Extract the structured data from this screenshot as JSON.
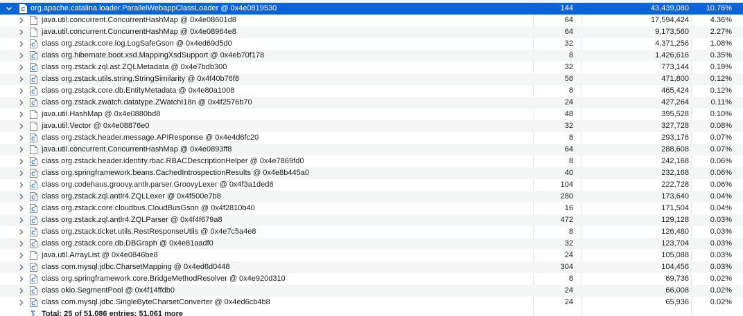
{
  "root": {
    "label": "org.apache.catalina.loader.ParallelWebappClassLoader @ 0x4e0819530",
    "objects": "144",
    "retained": "43,439,080",
    "percent": "10.76%",
    "icon": "class-loader-icon"
  },
  "rows": [
    {
      "type": "object",
      "label": "java.util.concurrent.ConcurrentHashMap @ 0x4e08601d8",
      "objects": "64",
      "retained": "17,594,424",
      "percent": "4.36%"
    },
    {
      "type": "object",
      "label": "java.util.concurrent.ConcurrentHashMap @ 0x4e08964e8",
      "objects": "64",
      "retained": "9,173,560",
      "percent": "2.27%"
    },
    {
      "type": "class",
      "label": "class org.zstack.core.log.LogSafeGson @ 0x4ed69d5d0",
      "objects": "32",
      "retained": "4,371,256",
      "percent": "1.08%"
    },
    {
      "type": "class",
      "label": "class org.hibernate.boot.xsd.MappingXsdSupport @ 0x4eb70f178",
      "objects": "8",
      "retained": "1,426,616",
      "percent": "0.35%"
    },
    {
      "type": "class",
      "label": "class org.zstack.zql.ast.ZQLMetadata @ 0x4e7bdb300",
      "objects": "32",
      "retained": "773,144",
      "percent": "0.19%"
    },
    {
      "type": "class",
      "label": "class org.zstack.utils.string.StringSimilarity @ 0x4f40b76f8",
      "objects": "56",
      "retained": "471,800",
      "percent": "0.12%"
    },
    {
      "type": "class",
      "label": "class org.zstack.core.db.EntityMetadata @ 0x4e80a1008",
      "objects": "8",
      "retained": "465,424",
      "percent": "0.12%"
    },
    {
      "type": "class",
      "label": "class org.zstack.zwatch.datatype.ZWatchI18n @ 0x4f2576b70",
      "objects": "24",
      "retained": "427,264",
      "percent": "0.11%"
    },
    {
      "type": "object",
      "label": "java.util.HashMap @ 0x4e0880bd8",
      "objects": "48",
      "retained": "395,528",
      "percent": "0.10%"
    },
    {
      "type": "object",
      "label": "java.util.Vector @ 0x4e08876e0",
      "objects": "32",
      "retained": "327,728",
      "percent": "0.08%"
    },
    {
      "type": "class",
      "label": "class org.zstack.header.message.APIResponse @ 0x4e4d6fc20",
      "objects": "8",
      "retained": "293,176",
      "percent": "0.07%"
    },
    {
      "type": "object",
      "label": "java.util.concurrent.ConcurrentHashMap @ 0x4e0893ff8",
      "objects": "64",
      "retained": "288,608",
      "percent": "0.07%"
    },
    {
      "type": "class",
      "label": "class org.zstack.header.identity.rbac.RBACDescriptionHelper @ 0x4e7869fd0",
      "objects": "8",
      "retained": "242,168",
      "percent": "0.06%"
    },
    {
      "type": "class",
      "label": "class org.springframework.beans.CachedIntrospectionResults @ 0x4e8b445a0",
      "objects": "40",
      "retained": "232,168",
      "percent": "0.06%"
    },
    {
      "type": "class",
      "label": "class org.codehaus.groovy.antlr.parser.GroovyLexer @ 0x4f3a1ded8",
      "objects": "104",
      "retained": "222,728",
      "percent": "0.06%"
    },
    {
      "type": "class",
      "label": "class org.zstack.zql.antlr4.ZQLLexer @ 0x4f500e7b8",
      "objects": "280",
      "retained": "173,640",
      "percent": "0.04%"
    },
    {
      "type": "class",
      "label": "class org.zstack.core.cloudbus.CloudBusGson @ 0x4f2810b40",
      "objects": "16",
      "retained": "171,504",
      "percent": "0.04%"
    },
    {
      "type": "class",
      "label": "class org.zstack.zql.antlr4.ZQLParser @ 0x4f4f679a8",
      "objects": "472",
      "retained": "129,128",
      "percent": "0.03%"
    },
    {
      "type": "class",
      "label": "class org.zstack.ticket.utils.RestResponseUtils @ 0x4e7c5a4e8",
      "objects": "8",
      "retained": "126,480",
      "percent": "0.03%"
    },
    {
      "type": "class",
      "label": "class org.zstack.core.db.DBGraph @ 0x4e81aadf0",
      "objects": "32",
      "retained": "123,704",
      "percent": "0.03%"
    },
    {
      "type": "object",
      "label": "java.util.ArrayList @ 0x4e0846be8",
      "objects": "24",
      "retained": "105,088",
      "percent": "0.03%"
    },
    {
      "type": "class",
      "label": "class com.mysql.jdbc.CharsetMapping @ 0x4ed6d0448",
      "objects": "304",
      "retained": "104,456",
      "percent": "0.03%"
    },
    {
      "type": "class",
      "label": "class org.springframework.core.BridgeMethodResolver @ 0x4e920d310",
      "objects": "8",
      "retained": "69,736",
      "percent": "0.02%"
    },
    {
      "type": "class",
      "label": "class okio.SegmentPool @ 0x4f14ffdb0",
      "objects": "24",
      "retained": "66,008",
      "percent": "0.02%"
    },
    {
      "type": "class",
      "label": "class com.mysql.jdbc.SingleByteCharsetConverter @ 0x4ed6cb4b8",
      "objects": "24",
      "retained": "65,936",
      "percent": "0.02%"
    }
  ],
  "footer": {
    "sigma": "∑",
    "total": "Total: 25 of 51,086 entries; 51,061 more"
  },
  "colors": {
    "selection": "#0a64d6",
    "alt_row": "#f4f5f5",
    "class_icon": "#2a6fd1"
  }
}
